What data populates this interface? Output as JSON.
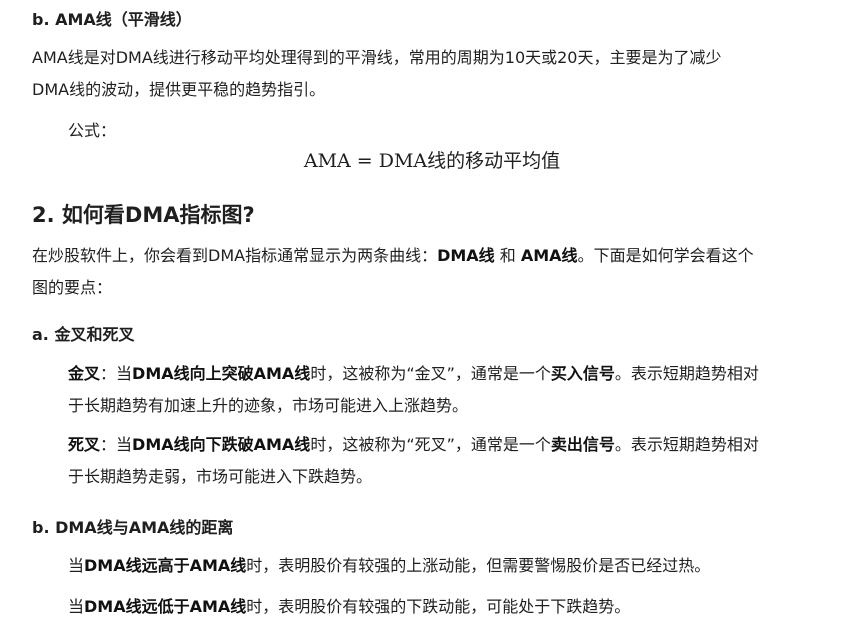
{
  "section_b": {
    "heading": "b. AMA线（平滑线）",
    "intro_line1": "AMA线是对DMA线进行移动平均处理得到的平滑线，常用的周期为10天或20天，主要是为了减少",
    "intro_line2": "DMA线的波动，提供更平稳的趋势指引。",
    "formula_label": "公式：",
    "formula": "AMA = DMA线的移动平均值"
  },
  "section_2": {
    "heading": "2. 如何看DMA指标图?",
    "intro_part1": "在炒股软件上，你会看到DMA指标通常显示为两条曲线：",
    "intro_bold1": "DMA线",
    "intro_part2": " 和 ",
    "intro_bold2": "AMA线",
    "intro_part3": "。下面是如何学会看这个",
    "intro_line2": "图的要点："
  },
  "cross": {
    "heading": "a. 金叉和死叉",
    "golden": {
      "term": "金叉",
      "colon": "：当",
      "cond": "DMA线向上突破AMA线",
      "mid": "时，这被称为“金叉”，通常是一个",
      "signal": "买入信号",
      "tail": "。表示短期趋势相对",
      "line2": "于长期趋势有加速上升的迹象，市场可能进入上涨趋势。"
    },
    "death": {
      "term": "死叉",
      "colon": "：当",
      "cond": "DMA线向下跌破AMA线",
      "mid": "时，这被称为“死叉”，通常是一个",
      "signal": "卖出信号",
      "tail": "。表示短期趋势相对",
      "line2": "于长期趋势走弱，市场可能进入下跌趋势。"
    }
  },
  "distance": {
    "heading": "b. DMA线与AMA线的距离",
    "high": {
      "prefix": "当",
      "bold": "DMA线远高于AMA线",
      "rest": "时，表明股价有较强的上涨动能，但需要警惕股价是否已经过热。"
    },
    "low": {
      "prefix": "当",
      "bold": "DMA线远低于AMA线",
      "rest": "时，表明股价有较强的下跌动能，可能处于下跌趋势。"
    }
  }
}
